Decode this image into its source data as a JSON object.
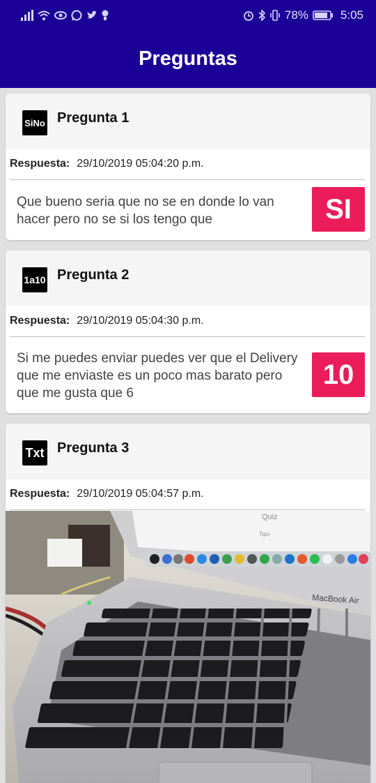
{
  "status_bar": {
    "battery": "78%",
    "time": "5:05"
  },
  "app_bar": {
    "title": "Preguntas"
  },
  "cards": [
    {
      "icon_text": "SiNo",
      "title": "Pregunta 1",
      "response_label": "Respuesta:",
      "response_date": "29/10/2019 05:04:20 p.m.",
      "answer_text": "Que bueno seria que no se en donde lo van hacer pero no se si los tengo que",
      "badge": "SI"
    },
    {
      "icon_text": "1a10",
      "title": "Pregunta 2",
      "response_label": "Respuesta:",
      "response_date": "29/10/2019 05:04:30 p.m.",
      "answer_text": "Si me puedes enviar puedes ver que el Delivery que me enviaste es un poco mas barato pero que me gusta que 6",
      "badge": "10"
    },
    {
      "icon_text": "Txt",
      "title": "Pregunta 3",
      "response_label": "Respuesta:",
      "response_date": "29/10/2019 05:04:57 p.m.",
      "photo": {
        "screen_text_1": "Quiz",
        "screen_text_2": "Tipo",
        "brand_text": "MacBook Air"
      }
    }
  ]
}
